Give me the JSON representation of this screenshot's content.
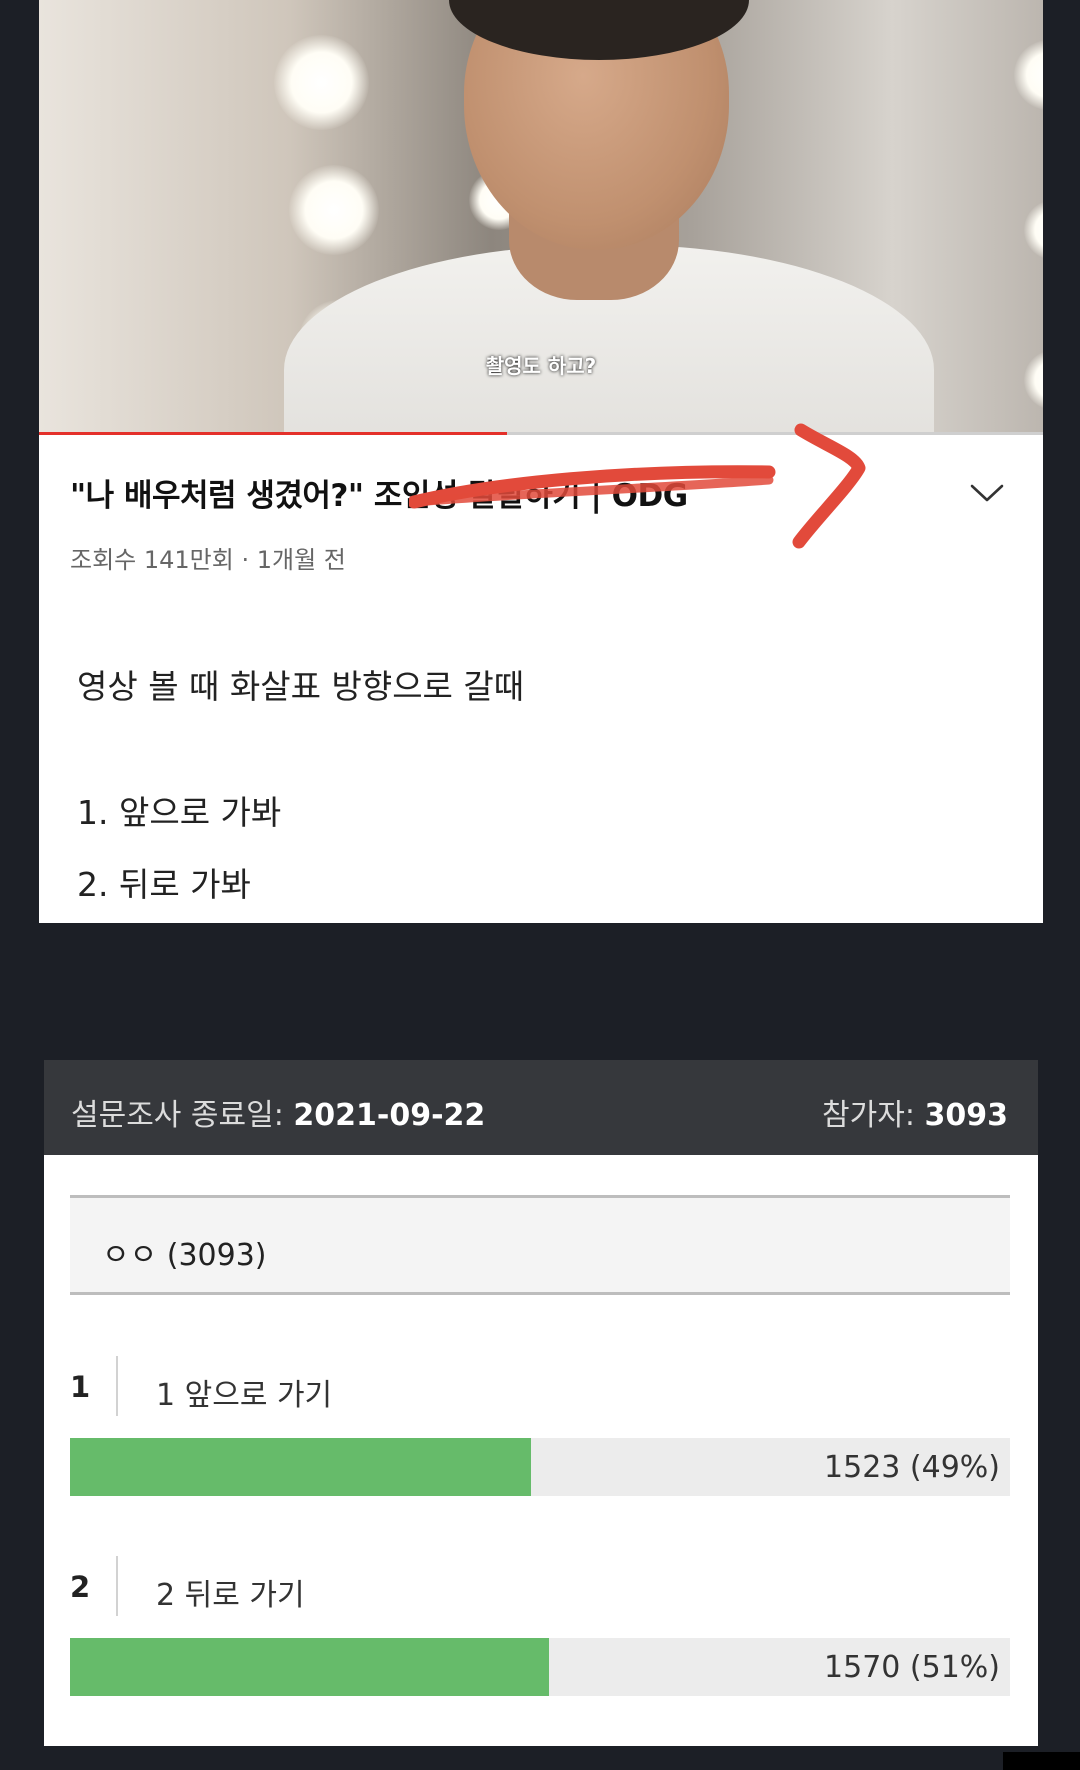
{
  "video": {
    "caption": "촬영도 하고?",
    "progress": 0.466,
    "title": "\"나 배우처럼 생겼어?\" 조인성 탈탈하기 | ODG",
    "meta": "조회수 141만회 · 1개월 전",
    "accent_color": "#e4302a"
  },
  "post": {
    "question": "영상 볼 때 화살표 방향으로 갈때",
    "options": [
      "1. 앞으로 가봐",
      "2. 뒤로 가봐"
    ]
  },
  "poll": {
    "end_label": "설문조사 종료일: ",
    "end_date": "2021-09-22",
    "participants_label": "참가자: ",
    "participants": "3093",
    "question": "ㅇㅇ (3093)",
    "bar_color": "#66bb6a",
    "choices": [
      {
        "num": "1",
        "label": "1 앞으로 가기",
        "value": "1523 (49%)",
        "fraction": 0.49
      },
      {
        "num": "2",
        "label": "2 뒤로 가기",
        "value": "1570 (51%)",
        "fraction": 0.51
      }
    ]
  }
}
